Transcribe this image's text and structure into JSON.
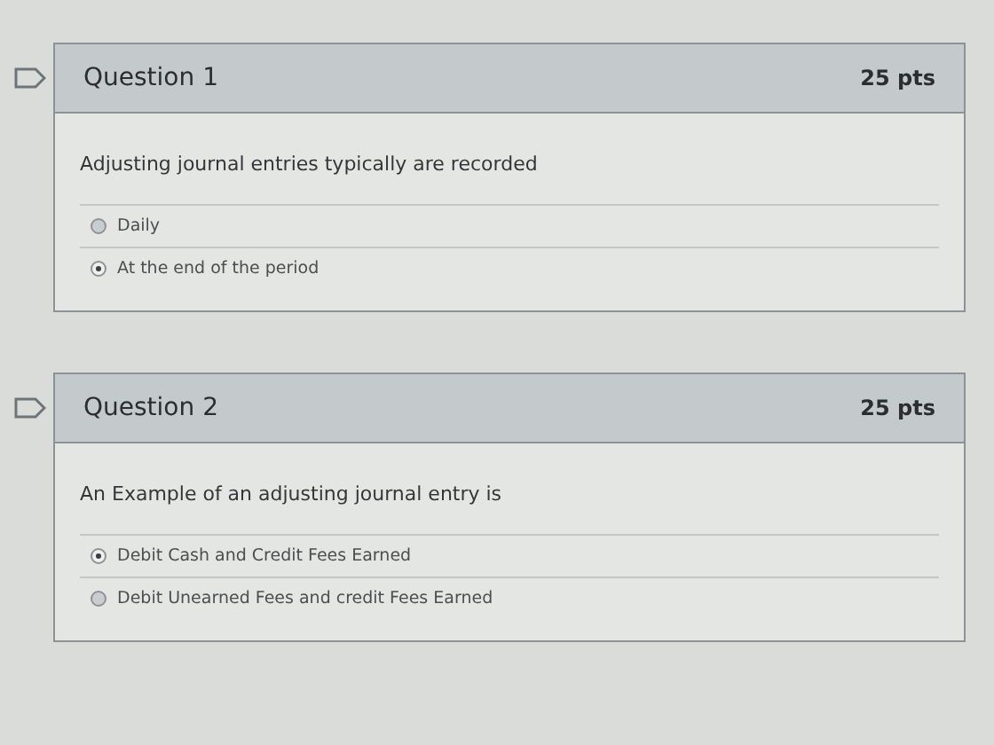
{
  "questions": [
    {
      "title": "Question 1",
      "points": "25 pts",
      "prompt": "Adjusting journal entries typically are recorded",
      "answers": [
        {
          "label": "Daily",
          "selected": false
        },
        {
          "label": "At the end of the period",
          "selected": true
        }
      ]
    },
    {
      "title": "Question 2",
      "points": "25 pts",
      "prompt": "An Example of an adjusting journal entry is",
      "answers": [
        {
          "label": "Debit Cash and Credit Fees Earned",
          "selected": true
        },
        {
          "label": "Debit Unearned Fees and credit Fees Earned",
          "selected": false
        }
      ]
    }
  ]
}
